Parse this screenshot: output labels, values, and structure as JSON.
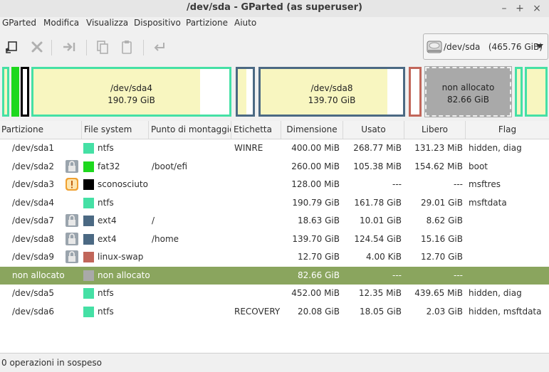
{
  "window": {
    "title": "/dev/sda - GParted (as superuser)"
  },
  "menu": [
    "GParted",
    "Modifica",
    "Visualizza",
    "Dispositivo",
    "Partizione",
    "Aiuto"
  ],
  "toolbar": {
    "buttons": [
      "new-partition-icon",
      "delete-icon",
      "resize-move-icon",
      "copy-icon",
      "paste-icon",
      "undo-icon"
    ]
  },
  "device": {
    "label": "/dev/sda   (465.76 GiB)",
    "icon": "hard-disk-icon"
  },
  "diskmap": {
    "sda4": {
      "name": "/dev/sda4",
      "size": "190.79 GiB",
      "used_fraction": 0.85
    },
    "sda8": {
      "name": "/dev/sda8",
      "size": "139.70 GiB",
      "used_fraction": 0.89
    },
    "unallocated": {
      "name": "non allocato",
      "size": "82.66 GiB"
    }
  },
  "columns": [
    "Partizione",
    "File system",
    "Punto di montaggio",
    "Etichetta",
    "Dimensione",
    "Usato",
    "Libero",
    "Flag"
  ],
  "rows": [
    {
      "partition": "/dev/sda1",
      "icon": "",
      "fs": "ntfs",
      "color": "#45e0a5",
      "mount": "",
      "label": "WINRE",
      "size": "400.00 MiB",
      "used": "268.77 MiB",
      "free": "131.23 MiB",
      "flags": "hidden, diag"
    },
    {
      "partition": "/dev/sda2",
      "icon": "lock-icon",
      "fs": "fat32",
      "color": "#1ed81e",
      "mount": "/boot/efi",
      "label": "",
      "size": "260.00 MiB",
      "used": "105.38 MiB",
      "free": "154.62 MiB",
      "flags": "boot"
    },
    {
      "partition": "/dev/sda3",
      "icon": "warning-icon",
      "fs": "sconosciuto",
      "color": "#000000",
      "mount": "",
      "label": "",
      "size": "128.00 MiB",
      "used": "---",
      "free": "---",
      "flags": "msftres"
    },
    {
      "partition": "/dev/sda4",
      "icon": "",
      "fs": "ntfs",
      "color": "#45e0a5",
      "mount": "",
      "label": "",
      "size": "190.79 GiB",
      "used": "161.78 GiB",
      "free": "29.01 GiB",
      "flags": "msftdata"
    },
    {
      "partition": "/dev/sda7",
      "icon": "lock-icon",
      "fs": "ext4",
      "color": "#4b6983",
      "mount": "/",
      "label": "",
      "size": "18.63 GiB",
      "used": "10.01 GiB",
      "free": "8.62 GiB",
      "flags": ""
    },
    {
      "partition": "/dev/sda8",
      "icon": "lock-icon",
      "fs": "ext4",
      "color": "#4b6983",
      "mount": "/home",
      "label": "",
      "size": "139.70 GiB",
      "used": "124.54 GiB",
      "free": "15.16 GiB",
      "flags": ""
    },
    {
      "partition": "/dev/sda9",
      "icon": "lock-icon",
      "fs": "linux-swap",
      "color": "#c1665a",
      "mount": "",
      "label": "",
      "size": "12.70 GiB",
      "used": "4.00 KiB",
      "free": "12.70 GiB",
      "flags": ""
    },
    {
      "partition": "non allocato",
      "icon": "",
      "fs": "non allocato",
      "color": "#a9a9a9",
      "mount": "",
      "label": "",
      "size": "82.66 GiB",
      "used": "---",
      "free": "---",
      "flags": "",
      "selected": true
    },
    {
      "partition": "/dev/sda5",
      "icon": "",
      "fs": "ntfs",
      "color": "#45e0a5",
      "mount": "",
      "label": "",
      "size": "452.00 MiB",
      "used": "12.35 MiB",
      "free": "439.65 MiB",
      "flags": "hidden, diag"
    },
    {
      "partition": "/dev/sda6",
      "icon": "",
      "fs": "ntfs",
      "color": "#45e0a5",
      "mount": "",
      "label": "RECOVERY",
      "size": "20.08 GiB",
      "used": "18.05 GiB",
      "free": "2.03 GiB",
      "flags": "hidden, msftdata"
    }
  ],
  "status": "0 operazioni in sospeso"
}
